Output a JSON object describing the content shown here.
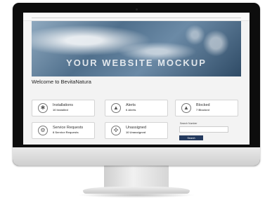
{
  "hero": {
    "title": "YOUR WEBSITE MOCKUP"
  },
  "welcome": "Welcome to BevitaNatura",
  "cards": [
    {
      "title": "Installations",
      "sub": "10 Installed",
      "icon": "wrench-icon"
    },
    {
      "title": "Alerts",
      "sub": "6 Alerts",
      "icon": "alert-icon"
    },
    {
      "title": "Blocked",
      "sub": "7 Blocked",
      "icon": "warning-icon"
    },
    {
      "title": "Service Requests",
      "sub": "8 Service Requests",
      "icon": "service-icon"
    },
    {
      "title": "Unassigned",
      "sub": "10 Unassigned",
      "icon": "network-icon"
    }
  ],
  "search": {
    "label": "Search Number",
    "button": "Search"
  }
}
